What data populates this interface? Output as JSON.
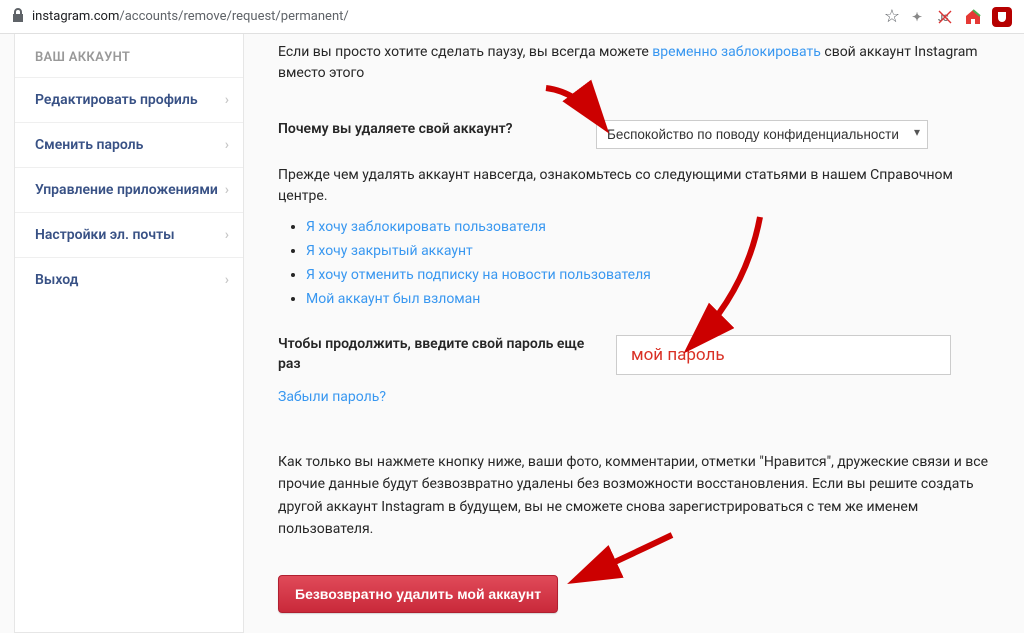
{
  "address_bar": {
    "url_domain": "instagram.com",
    "url_path": "/accounts/remove/request/permanent/"
  },
  "sidebar": {
    "title": "ВАШ АККАУНТ",
    "items": [
      {
        "label": "Редактировать профиль"
      },
      {
        "label": "Сменить пароль"
      },
      {
        "label": "Управление приложениями"
      },
      {
        "label": "Настройки эл. почты"
      },
      {
        "label": "Выход"
      }
    ]
  },
  "main": {
    "intro_pre": "Если вы просто хотите сделать паузу, вы всегда можете ",
    "intro_link": "временно заблокировать",
    "intro_post": " свой аккаунт Instagram вместо этого",
    "reason_label": "Почему вы удаляете свой аккаунт?",
    "reason_selected": "Беспокойство по поводу конфиденциальности",
    "help_intro": "Прежде чем удалять аккаунт навсегда, ознакомьтесь со следующими статьями в нашем Справочном центре.",
    "help_links": [
      "Я хочу заблокировать пользователя",
      "Я хочу закрытый аккаунт",
      "Я хочу отменить подписку на новости пользователя",
      "Мой аккаунт был взломан"
    ],
    "password_label": "Чтобы продолжить, введите свой пароль еще раз",
    "password_value": "мой пароль",
    "forgot": "Забыли пароль?",
    "warning": "Как только вы нажмете кнопку ниже, ваши фото, комментарии, отметки \"Нравится\", дружеские связи и все прочие данные будут безвозвратно удалены без возможности восстановления. Если вы решите создать другой аккаунт Instagram в будущем, вы не сможете снова зарегистрироваться с тем же именем пользователя.",
    "delete_button": "Безвозвратно удалить мой аккаунт"
  },
  "arrow_color": "#cc0000"
}
